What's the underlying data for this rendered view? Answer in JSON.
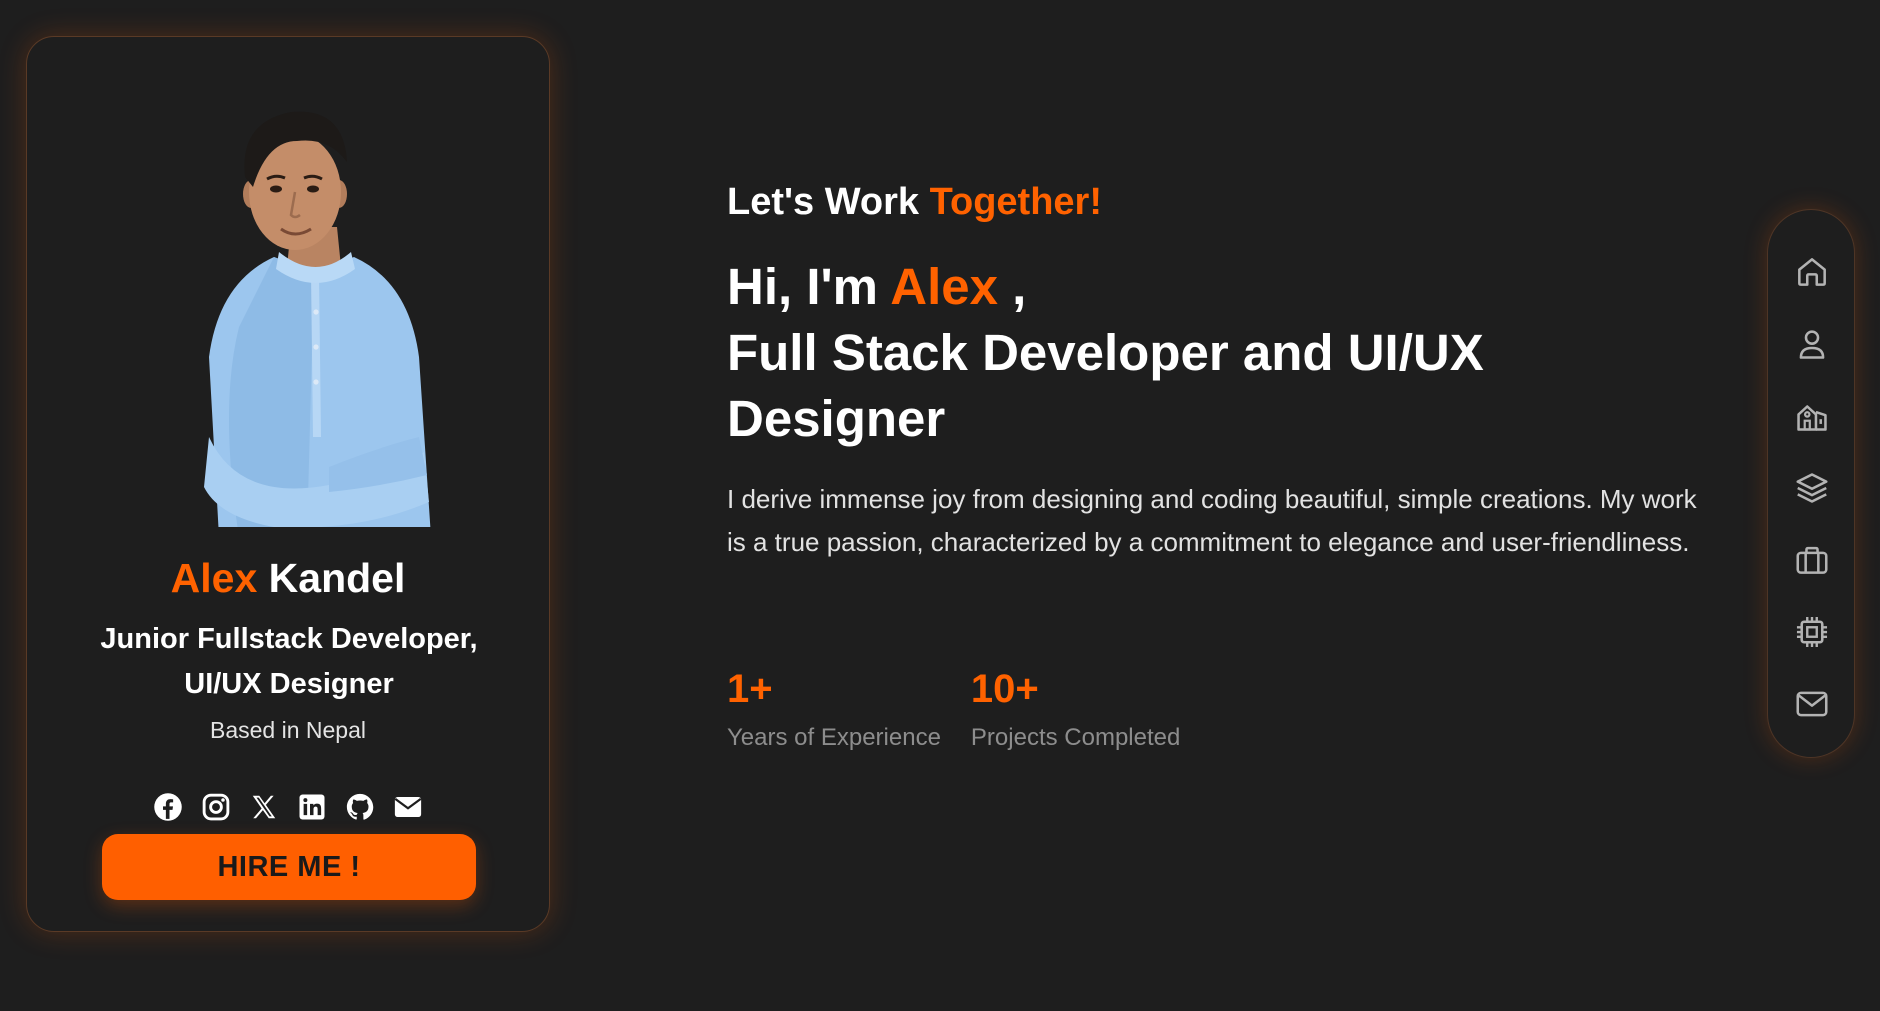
{
  "colors": {
    "background": "#1e1e1e",
    "accent": "#ff6200",
    "button": "#ff5f00",
    "text": "#ffffff",
    "muted": "#8d8d8d"
  },
  "profile": {
    "first_name": "Alex",
    "last_name": "Kandel",
    "role_line1": "Junior Fullstack Developer,",
    "role_line2": "UI/UX Designer",
    "location": "Based in Nepal",
    "social_icons": [
      "facebook-icon",
      "instagram-icon",
      "x-twitter-icon",
      "linkedin-icon",
      "github-icon",
      "email-icon"
    ],
    "hire_button_label": "HIRE ME !"
  },
  "hero": {
    "kicker_prefix": "Let's Work",
    "kicker_accent": "Together!",
    "greeting_prefix": "Hi, I'm",
    "greeting_name": "Alex",
    "greeting_suffix": ",",
    "title": "Full Stack Developer and UI/UX Designer",
    "description": "I derive immense joy from designing and coding beautiful, simple creations. My work is a true passion, characterized by a commitment to elegance and user-friendliness.",
    "stats": [
      {
        "value": "1+",
        "label": "Years of Experience"
      },
      {
        "value": "10+",
        "label": "Projects Completed"
      }
    ]
  },
  "side_nav": {
    "items": [
      "home-icon",
      "user-icon",
      "building-icon",
      "layers-icon",
      "briefcase-icon",
      "chip-icon",
      "mail-icon"
    ]
  }
}
